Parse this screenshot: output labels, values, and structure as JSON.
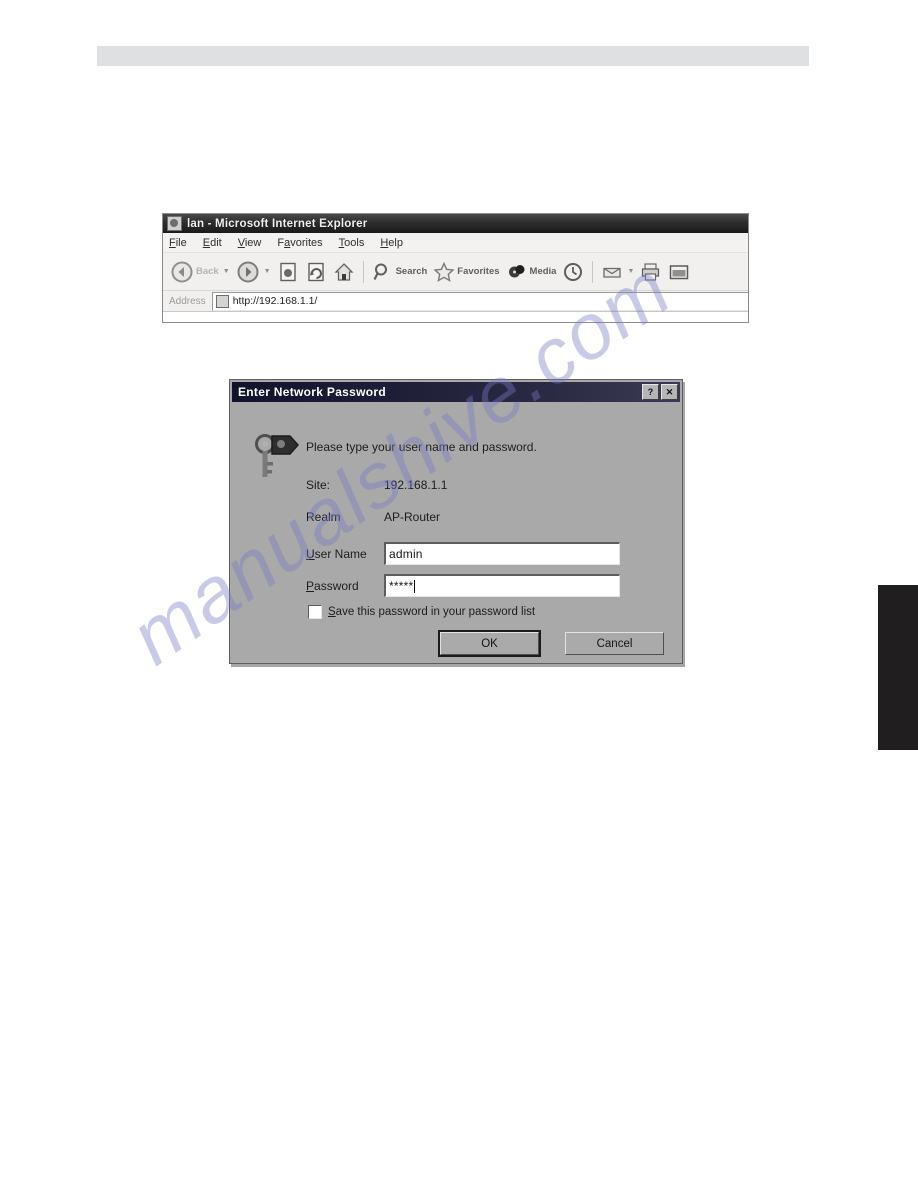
{
  "page": {
    "header_band_label": "",
    "watermark": "manualshive.com",
    "edge_tab_label": ""
  },
  "browser": {
    "title": "lan - Microsoft Internet Explorer",
    "title_icon": "ie-logo-icon",
    "menu": [
      {
        "label": "File",
        "mnemonic": "F"
      },
      {
        "label": "Edit",
        "mnemonic": "E"
      },
      {
        "label": "View",
        "mnemonic": "V"
      },
      {
        "label": "Favorites",
        "mnemonic": "a"
      },
      {
        "label": "Tools",
        "mnemonic": "T"
      },
      {
        "label": "Help",
        "mnemonic": "H"
      }
    ],
    "toolbar": [
      {
        "label": "Back",
        "icon": "back-arrow-icon"
      },
      {
        "label": "",
        "icon": "forward-arrow-icon"
      },
      {
        "label": "",
        "icon": "stop-icon"
      },
      {
        "label": "",
        "icon": "refresh-icon"
      },
      {
        "label": "",
        "icon": "home-icon"
      },
      {
        "label": "Search",
        "icon": "search-icon"
      },
      {
        "label": "Favorites",
        "icon": "star-icon"
      },
      {
        "label": "Media",
        "icon": "media-icon"
      },
      {
        "label": "",
        "icon": "history-icon"
      },
      {
        "label": "",
        "icon": "mail-icon"
      },
      {
        "label": "",
        "icon": "print-icon"
      },
      {
        "label": "",
        "icon": "edit-page-icon"
      }
    ],
    "address": {
      "label": "Address",
      "value": "http://192.168.1.1/",
      "placeholder": "http://",
      "icon": "page-icon"
    }
  },
  "dialog": {
    "title": "Enter Network Password",
    "title_buttons": [
      {
        "name": "help-button",
        "glyph": "?"
      },
      {
        "name": "close-button",
        "glyph": "✕"
      }
    ],
    "icon": "key-lock-icon",
    "prompt": "Please type your user name and password.",
    "site_label": "Site:",
    "site_value": "192.168.1.1",
    "realm_label": "Realm",
    "realm_value": "AP-Router",
    "username_label": "User Name",
    "username_mnemonic": "U",
    "username_value": "admin",
    "password_label": "Password",
    "password_mnemonic": "P",
    "password_value": "*****",
    "save_checkbox_label": "Save this password in your password list",
    "save_checkbox_mnemonic": "S",
    "save_checkbox_checked": false,
    "ok_label": "OK",
    "cancel_label": "Cancel"
  }
}
